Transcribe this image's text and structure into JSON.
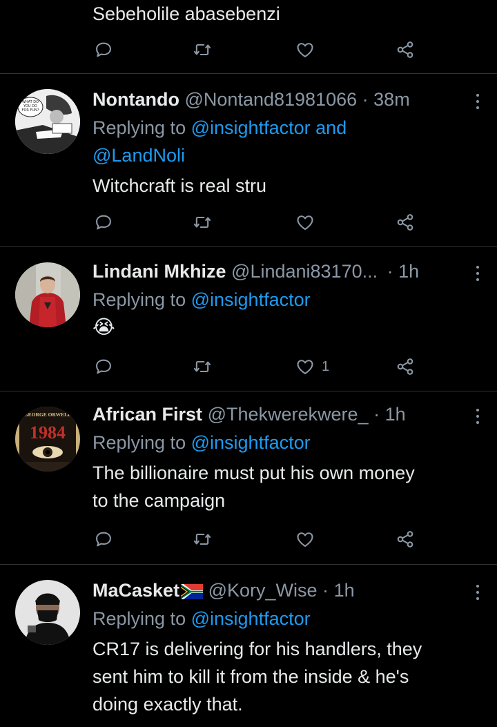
{
  "tweets": [
    {
      "text_lines": [
        "Sebeholile abasebenzi"
      ],
      "like_count": ""
    },
    {
      "name": "Nontando",
      "handle": "@Nontand81981066",
      "time": "38m",
      "reply_prefix": "Replying to",
      "mentions_line1": "@insightfactor and",
      "mentions_line2": "@LandNoli",
      "text_lines": [
        "Witchcraft is real stru"
      ],
      "like_count": "",
      "avatar_text": [
        "WHAT DO",
        "YOU DO",
        "FOR FUN?"
      ]
    },
    {
      "name": "Lindani Mkhize",
      "handle": "@Lindani83170...",
      "time": "1h",
      "reply_prefix": "Replying to",
      "mentions_line1": "@insightfactor",
      "emoji": "😭",
      "like_count": "1"
    },
    {
      "name": "African First",
      "handle": "@Thekwerekwere_",
      "time": "1h",
      "reply_prefix": "Replying to",
      "mentions_line1": "@insightfactor",
      "text_lines": [
        "The billionaire  must put his own money",
        "to the campaign"
      ],
      "like_count": "",
      "avatar_text": [
        "GEORGE ORWELL",
        "1984"
      ]
    },
    {
      "name": "MaCasket",
      "handle": "@Kory_Wise",
      "time": "1h",
      "reply_prefix": "Replying to",
      "mentions_line1": "@insightfactor",
      "text_lines": [
        "CR17 is delivering for his handlers, they",
        "sent him to kill it from the inside & he's",
        "doing exactly that."
      ]
    }
  ],
  "separator": "·",
  "icons": [
    "reply-icon",
    "retweet-icon",
    "like-icon",
    "share-icon",
    "more-icon",
    "south-africa-flag-icon"
  ],
  "colors": {
    "background": "#000000",
    "text": "#e7e9ea",
    "muted": "#8b98a5",
    "link": "#1d9bf0",
    "divider": "#2f3336"
  }
}
